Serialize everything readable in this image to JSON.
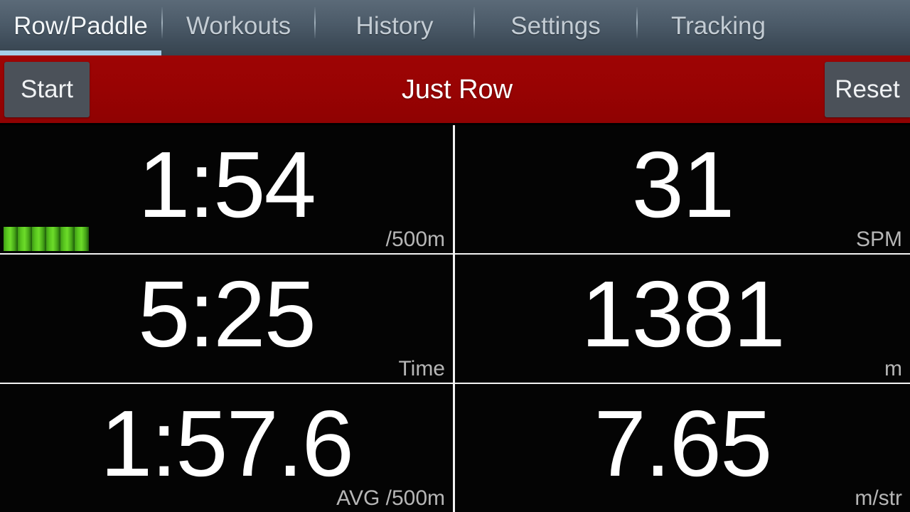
{
  "tabs": [
    {
      "label": "Row/Paddle",
      "active": true
    },
    {
      "label": "Workouts",
      "active": false
    },
    {
      "label": "History",
      "active": false
    },
    {
      "label": "Settings",
      "active": false
    },
    {
      "label": "Tracking",
      "active": false
    }
  ],
  "actionbar": {
    "start_label": "Start",
    "title": "Just Row",
    "reset_label": "Reset",
    "background_color": "#980303",
    "button_color": "#4b5159"
  },
  "metrics": [
    {
      "value": "1:54",
      "unit": "/500m"
    },
    {
      "value": "31",
      "unit": "SPM"
    },
    {
      "value": "5:25",
      "unit": "Time"
    },
    {
      "value": "1381",
      "unit": "m"
    },
    {
      "value": "1:57.6",
      "unit": "AVG /500m"
    },
    {
      "value": "7.65",
      "unit": "m/str"
    }
  ],
  "force_indicator": {
    "segments": 6,
    "color": "#5ec41d"
  },
  "colors": {
    "accent": "#a6cde8",
    "background": "#000000",
    "divider": "#f2f2f2",
    "unit_text": "#b6b6b6"
  }
}
